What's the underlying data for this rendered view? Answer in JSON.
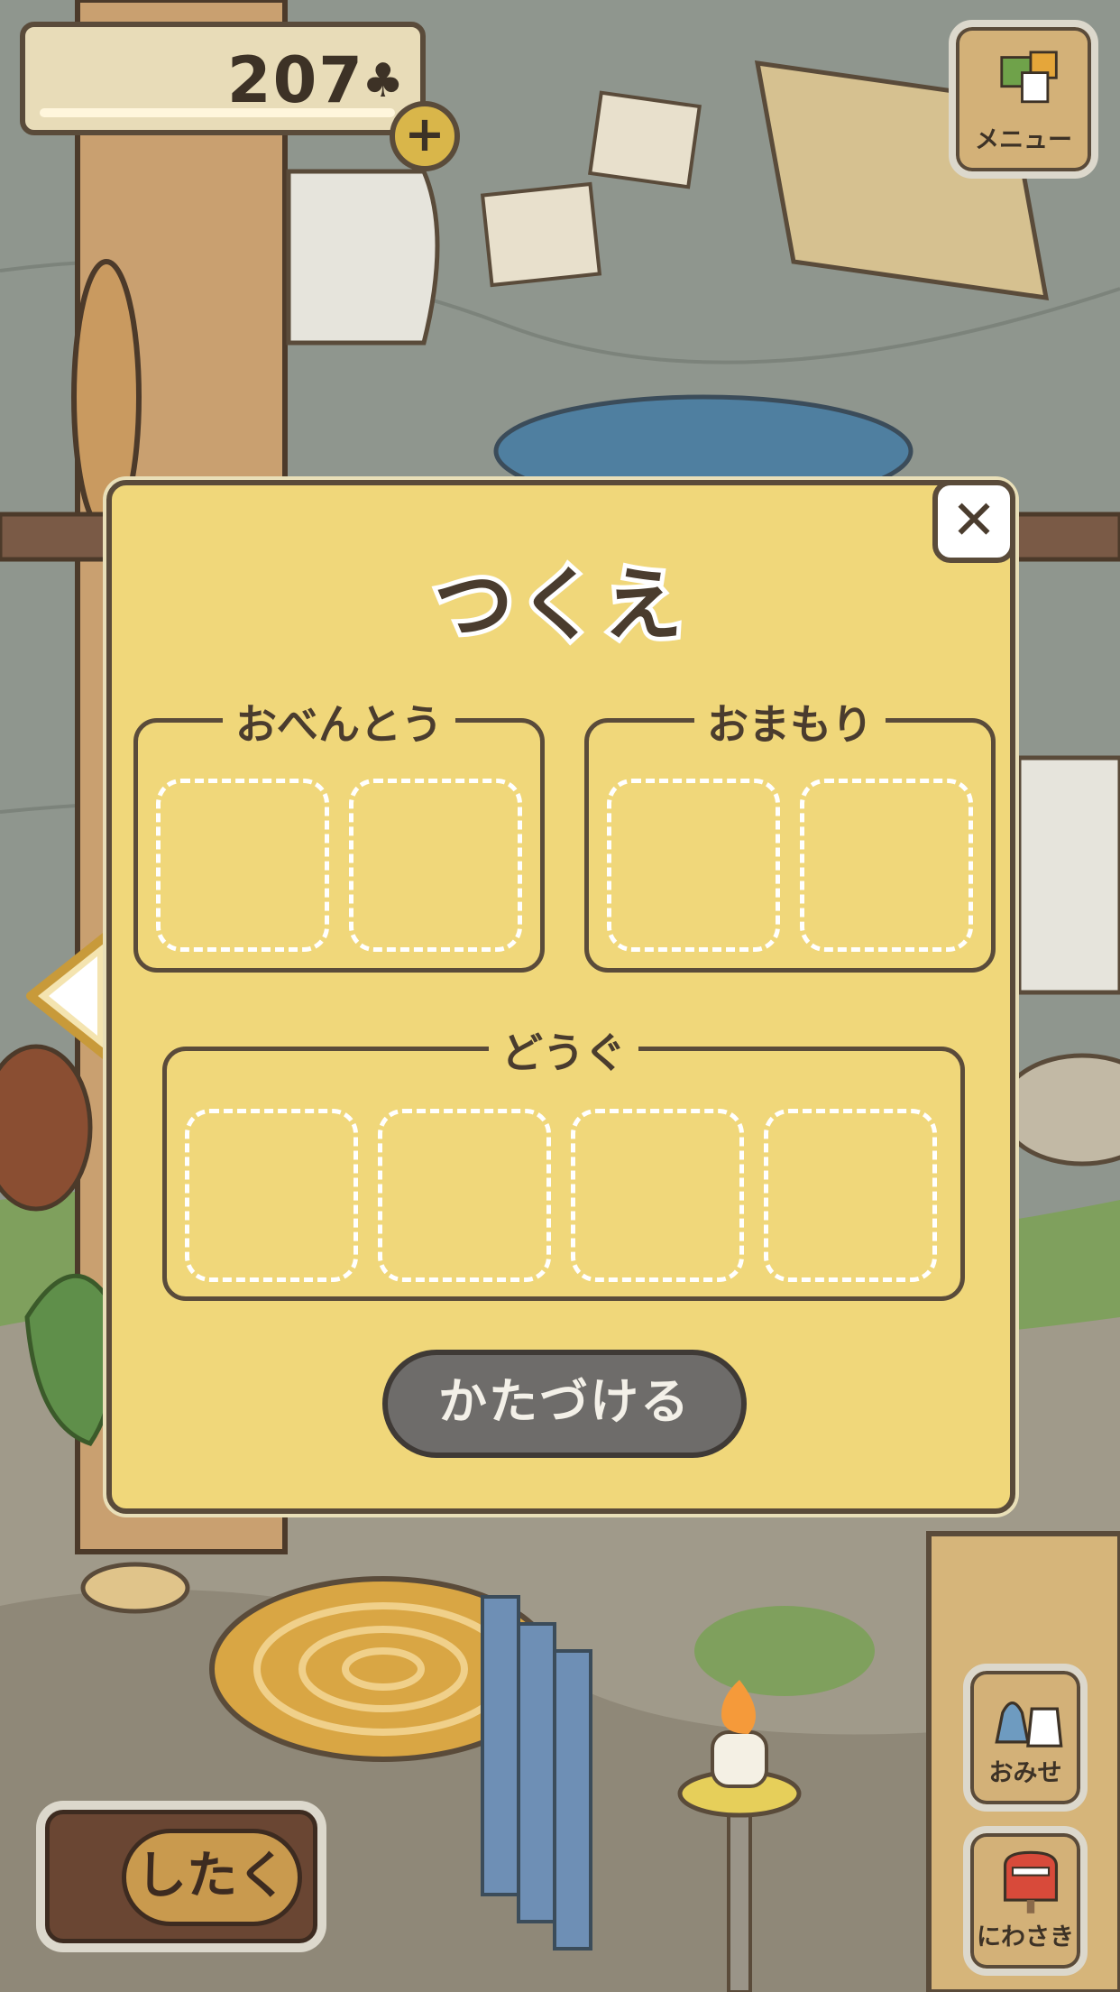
{
  "hud": {
    "clover_count": "207",
    "clover_symbol": "♣",
    "plus_label": "+"
  },
  "nav": {
    "menu_label": "メニュー",
    "shop_label": "おみせ",
    "mail_label": "にわさき",
    "prep_label": "したく"
  },
  "dialog": {
    "title": "つくえ",
    "close_label": "✕",
    "sections": [
      {
        "label": "おべんとう",
        "slots": 2
      },
      {
        "label": "おまもり",
        "slots": 2
      },
      {
        "label": "どうぐ",
        "slots": 4
      }
    ],
    "clear_button_label": "かたづける"
  },
  "colors": {
    "panel": "#f0d77a",
    "outline": "#5a4b3a",
    "clear_button": "#6e6c6a",
    "counter_bg": "#e8dcb8"
  }
}
